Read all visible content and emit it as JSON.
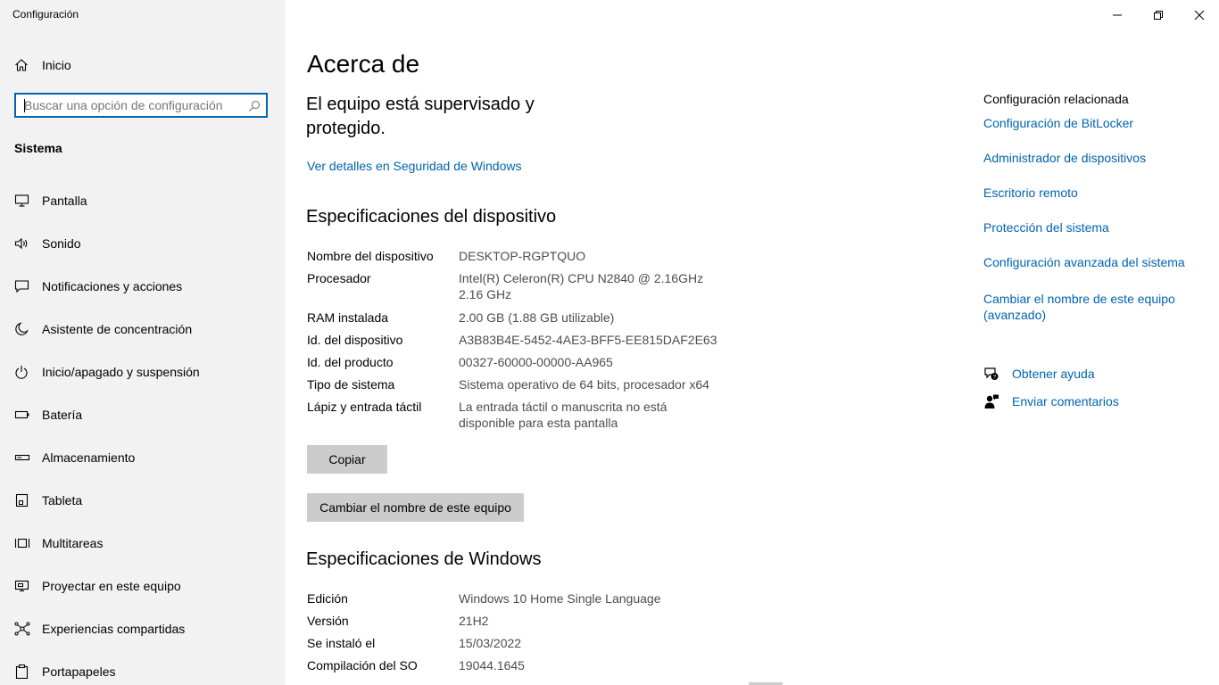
{
  "window": {
    "title": "Configuración",
    "minimize_label": "Minimizar",
    "maximize_label": "Restaurar",
    "close_label": "Cerrar"
  },
  "sidebar": {
    "home_label": "Inicio",
    "search_placeholder": "Buscar una opción de configuración",
    "section_label": "Sistema",
    "items": [
      {
        "label": "Pantalla",
        "icon": "monitor-icon"
      },
      {
        "label": "Sonido",
        "icon": "speaker-icon"
      },
      {
        "label": "Notificaciones y acciones",
        "icon": "notification-icon"
      },
      {
        "label": "Asistente de concentración",
        "icon": "moon-icon"
      },
      {
        "label": "Inicio/apagado y suspensión",
        "icon": "power-icon"
      },
      {
        "label": "Batería",
        "icon": "battery-icon"
      },
      {
        "label": "Almacenamiento",
        "icon": "storage-icon"
      },
      {
        "label": "Tableta",
        "icon": "tablet-icon"
      },
      {
        "label": "Multitareas",
        "icon": "multitask-icon"
      },
      {
        "label": "Proyectar en este equipo",
        "icon": "project-icon"
      },
      {
        "label": "Experiencias compartidas",
        "icon": "shared-icon"
      },
      {
        "label": "Portapapeles",
        "icon": "clipboard-icon"
      }
    ]
  },
  "main": {
    "title": "Acerca de",
    "protection_text": "El equipo está supervisado y protegido.",
    "security_link": "Ver detalles en Seguridad de Windows",
    "device_specs": {
      "heading": "Especificaciones del dispositivo",
      "rows": [
        {
          "key": "Nombre del dispositivo",
          "value": "DESKTOP-RGPTQUO"
        },
        {
          "key": "Procesador",
          "value": "Intel(R) Celeron(R) CPU  N2840  @ 2.16GHz   2.16 GHz"
        },
        {
          "key": "RAM instalada",
          "value": "2.00 GB (1.88 GB utilizable)"
        },
        {
          "key": "Id. del dispositivo",
          "value": "A3B83B4E-5452-4AE3-BFF5-EE815DAF2E63"
        },
        {
          "key": "Id. del producto",
          "value": "00327-60000-00000-AA965"
        },
        {
          "key": "Tipo de sistema",
          "value": "Sistema operativo de 64 bits, procesador x64"
        },
        {
          "key": "Lápiz y entrada táctil",
          "value": "La entrada táctil o manuscrita no está disponible para esta pantalla"
        }
      ],
      "copy_button": "Copiar",
      "rename_button": "Cambiar el nombre de este equipo"
    },
    "windows_specs": {
      "heading": "Especificaciones de Windows",
      "rows": [
        {
          "key": "Edición",
          "value": "Windows 10 Home Single Language"
        },
        {
          "key": "Versión",
          "value": "21H2"
        },
        {
          "key": "Se instaló el",
          "value": "15/03/2022"
        },
        {
          "key": "Compilación del SO",
          "value": "19044.1645"
        }
      ]
    }
  },
  "related": {
    "title": "Configuración relacionada",
    "links": [
      "Configuración de BitLocker",
      "Administrador de dispositivos",
      "Escritorio remoto",
      "Protección del sistema",
      "Configuración avanzada del sistema",
      "Cambiar el nombre de este equipo (avanzado)"
    ],
    "help_link": "Obtener ayuda",
    "feedback_link": "Enviar comentarios"
  }
}
